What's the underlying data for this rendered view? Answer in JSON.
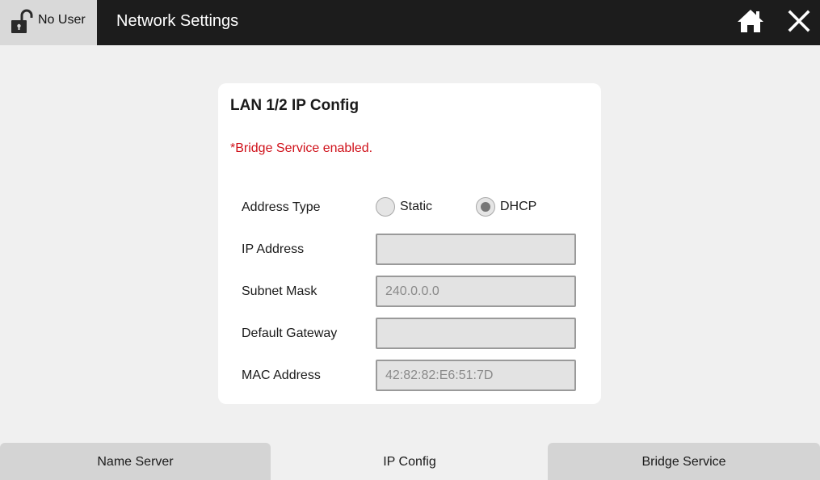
{
  "header": {
    "user_label": "No User",
    "title": "Network Settings",
    "icons": {
      "lock": "unlocked-padlock-icon",
      "home": "home-icon",
      "close": "close-icon"
    }
  },
  "card": {
    "title": "LAN 1/2 IP Config",
    "notice": "*Bridge Service enabled.",
    "address_type": {
      "label": "Address Type",
      "options": [
        "Static",
        "DHCP"
      ],
      "selected": "DHCP"
    },
    "fields": [
      {
        "label": "IP Address",
        "value": ""
      },
      {
        "label": "Subnet Mask",
        "value": "240.0.0.0"
      },
      {
        "label": "Default Gateway",
        "value": ""
      },
      {
        "label": "MAC Address",
        "value": "42:82:82:E6:51:7D"
      }
    ]
  },
  "tabs": [
    {
      "label": "Name Server",
      "active": false
    },
    {
      "label": "IP Config",
      "active": true
    },
    {
      "label": "Bridge Service",
      "active": false
    }
  ],
  "colors": {
    "topbar": "#1c1c1c",
    "notice": "#d0121b",
    "card": "#ffffff"
  }
}
